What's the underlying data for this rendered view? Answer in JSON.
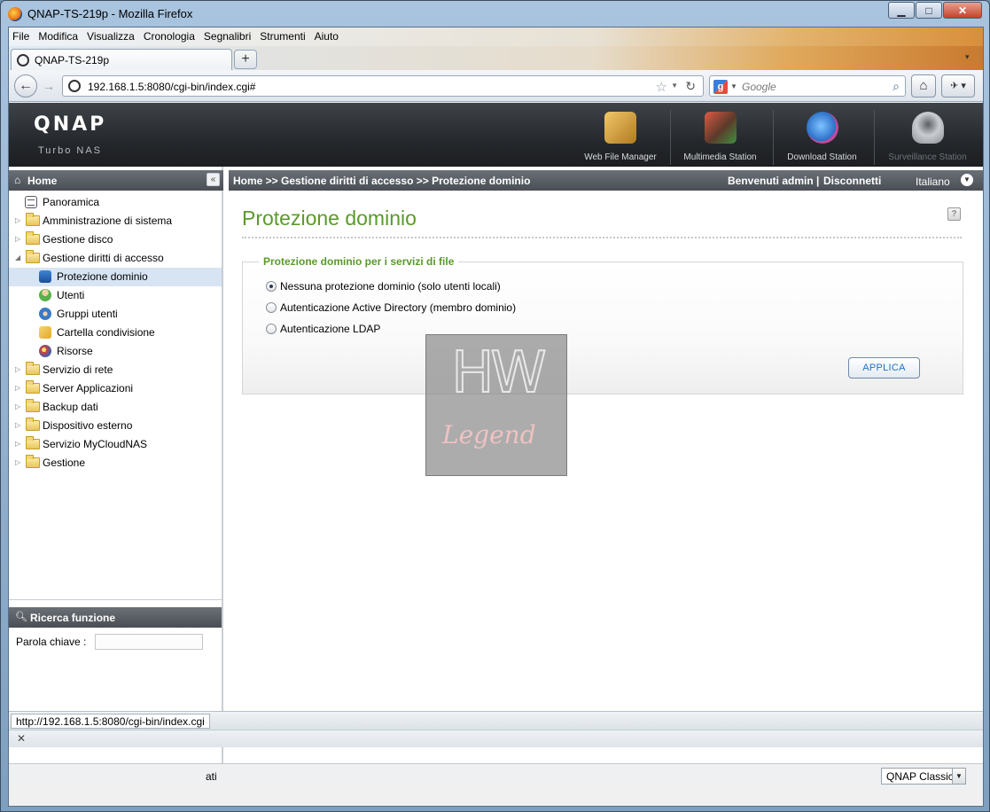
{
  "window": {
    "title": "QNAP-TS-219p - Mozilla Firefox",
    "controls": {
      "minimize": "▁",
      "maximize": "□",
      "close": "✕"
    }
  },
  "menu": [
    "File",
    "Modifica",
    "Visualizza",
    "Cronologia",
    "Segnalibri",
    "Strumenti",
    "Aiuto"
  ],
  "tab": {
    "label": "QNAP-TS-219p",
    "new_tab": "+"
  },
  "nav": {
    "url": "192.168.1.5:8080/cgi-bin/index.cgi#",
    "search_placeholder": "Google",
    "back": "←",
    "forward": "→"
  },
  "qnap": {
    "logo": "QNAP",
    "subtitle": "Turbo NAS",
    "stations": [
      "Web File Manager",
      "Multimedia Station",
      "Download Station",
      "Surveillance Station"
    ]
  },
  "sidebar": {
    "home_label": "Home",
    "tree": [
      {
        "label": "Panoramica",
        "level": 1,
        "icon": "overview-icon"
      },
      {
        "label": "Amministrazione di sistema",
        "level": 0
      },
      {
        "label": "Gestione disco",
        "level": 0
      },
      {
        "label": "Gestione diritti di accesso",
        "level": 0,
        "expanded": true
      },
      {
        "label": "Protezione dominio",
        "level": 1,
        "icon": "domain-icon",
        "selected": true
      },
      {
        "label": "Utenti",
        "level": 1,
        "icon": "user-icon"
      },
      {
        "label": "Gruppi utenti",
        "level": 1,
        "icon": "group-icon"
      },
      {
        "label": "Cartella condivisione",
        "level": 1,
        "icon": "share-folder-icon"
      },
      {
        "label": "Risorse",
        "level": 1,
        "icon": "resources-icon"
      },
      {
        "label": "Servizio di rete",
        "level": 0
      },
      {
        "label": "Server Applicazioni",
        "level": 0
      },
      {
        "label": "Backup dati",
        "level": 0
      },
      {
        "label": "Dispositivo esterno",
        "level": 0
      },
      {
        "label": "Servizio MyCloudNAS",
        "level": 0
      },
      {
        "label": "Gestione",
        "level": 0
      }
    ],
    "search": {
      "title": "Ricerca funzione",
      "keyword_label": "Parola chiave :"
    }
  },
  "header_bar": {
    "breadcrumb": "Home >> Gestione diritti di accesso >> Protezione dominio",
    "welcome": "Benvenuti admin",
    "separator": "|",
    "logout": "Disconnetti",
    "language": "Italiano"
  },
  "content": {
    "title": "Protezione dominio",
    "help": "?",
    "fieldset_legend": "Protezione dominio per i servizi di file",
    "options": [
      {
        "label": "Nessuna protezione dominio (solo utenti locali)",
        "checked": true
      },
      {
        "label": "Autenticazione Active Directory (membro dominio)",
        "checked": false
      },
      {
        "label": "Autenticazione LDAP",
        "checked": false
      }
    ],
    "apply": "APPLICA"
  },
  "watermark": {
    "top": "HW",
    "bottom": "Legend"
  },
  "footer": {
    "fragment": "ati",
    "theme": "QNAP Classic"
  },
  "status": {
    "url": "http://192.168.1.5:8080/cgi-bin/index.cgi",
    "close": "✕"
  }
}
